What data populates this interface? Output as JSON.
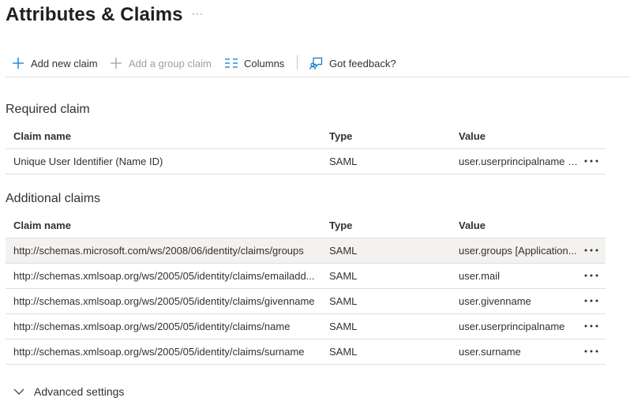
{
  "page": {
    "title": "Attributes & Claims",
    "more": "···"
  },
  "toolbar": {
    "add_new_claim": "Add new claim",
    "add_group_claim": "Add a group claim",
    "columns": "Columns",
    "feedback": "Got feedback?"
  },
  "required": {
    "title": "Required claim",
    "headers": {
      "name": "Claim name",
      "type": "Type",
      "value": "Value"
    },
    "rows": [
      {
        "name": "Unique User Identifier (Name ID)",
        "type": "SAML",
        "value": "user.userprincipalname [..."
      }
    ]
  },
  "additional": {
    "title": "Additional claims",
    "headers": {
      "name": "Claim name",
      "type": "Type",
      "value": "Value"
    },
    "rows": [
      {
        "name": "http://schemas.microsoft.com/ws/2008/06/identity/claims/groups",
        "type": "SAML",
        "value": "user.groups [Application..."
      },
      {
        "name": "http://schemas.xmlsoap.org/ws/2005/05/identity/claims/emailadd...",
        "type": "SAML",
        "value": "user.mail"
      },
      {
        "name": "http://schemas.xmlsoap.org/ws/2005/05/identity/claims/givenname",
        "type": "SAML",
        "value": "user.givenname"
      },
      {
        "name": "http://schemas.xmlsoap.org/ws/2005/05/identity/claims/name",
        "type": "SAML",
        "value": "user.userprincipalname"
      },
      {
        "name": "http://schemas.xmlsoap.org/ws/2005/05/identity/claims/surname",
        "type": "SAML",
        "value": "user.surname"
      }
    ]
  },
  "advanced": {
    "label": "Advanced settings"
  },
  "colors": {
    "accent": "#0078d4",
    "disabled": "#a19f9d",
    "selected_row": "#f3f2f1",
    "border": "#e1dfdd"
  },
  "icons": {
    "add": "plus-icon",
    "columns": "columns-icon",
    "feedback": "feedback-icon",
    "row_more": "ellipsis-icon",
    "advanced": "chevron-down-icon"
  }
}
